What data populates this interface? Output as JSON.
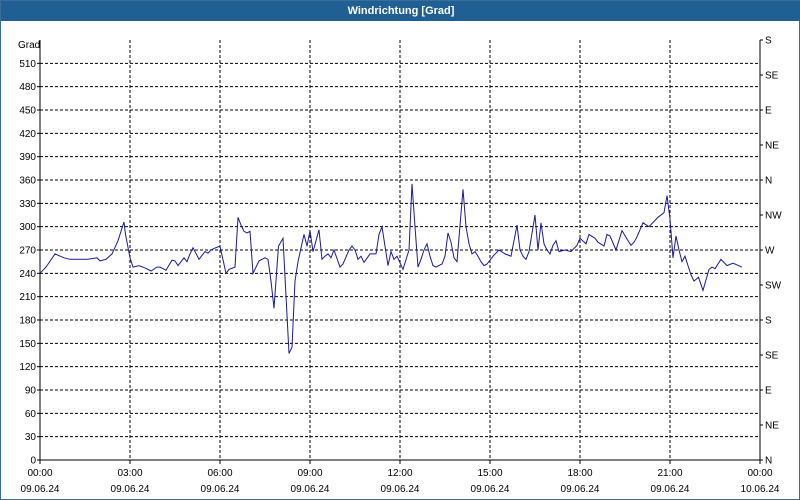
{
  "window": {
    "title": "Windrichtung [Grad]"
  },
  "chart_data": {
    "type": "line",
    "title": "Windrichtung [Grad]",
    "ylabel": "Grad",
    "ylim": [
      0,
      540
    ],
    "y_ticks": [
      0,
      30,
      60,
      90,
      120,
      150,
      180,
      210,
      240,
      270,
      300,
      330,
      360,
      390,
      420,
      450,
      480,
      510
    ],
    "right_axis_labels": [
      "N",
      "NE",
      "E",
      "SE",
      "S",
      "SW",
      "W",
      "NW",
      "N",
      "NE",
      "E",
      "SE",
      "S"
    ],
    "right_axis_values": [
      0,
      45,
      90,
      135,
      180,
      225,
      270,
      315,
      360,
      405,
      450,
      495,
      540
    ],
    "x_ticks": [
      {
        "time": "00:00",
        "date": "09.06.24"
      },
      {
        "time": "03:00",
        "date": "09.06.24"
      },
      {
        "time": "06:00",
        "date": "09.06.24"
      },
      {
        "time": "09:00",
        "date": "09.06.24"
      },
      {
        "time": "12:00",
        "date": "09.06.24"
      },
      {
        "time": "15:00",
        "date": "09.06.24"
      },
      {
        "time": "18:00",
        "date": "09.06.24"
      },
      {
        "time": "21:00",
        "date": "09.06.24"
      },
      {
        "time": "00:00",
        "date": "10.06.24"
      }
    ],
    "xlim_hours": [
      0,
      24
    ],
    "grid": true,
    "line_color": "#1a1a9c",
    "series": [
      {
        "x_hours": [
          0.0,
          0.2,
          0.5,
          0.8,
          1.0,
          1.3,
          1.6,
          1.9,
          2.0,
          2.2,
          2.4,
          2.6,
          2.8,
          2.85,
          3.0,
          3.1,
          3.3,
          3.5,
          3.7,
          3.9,
          4.0,
          4.2,
          4.4,
          4.5,
          4.6,
          4.8,
          4.9,
          5.0,
          5.1,
          5.3,
          5.5,
          5.6,
          5.7,
          5.8,
          6.0,
          6.2,
          6.3,
          6.5,
          6.6,
          6.7,
          6.8,
          6.9,
          7.0,
          7.1,
          7.3,
          7.5,
          7.6,
          7.7,
          7.8,
          7.95,
          8.1,
          8.3,
          8.4,
          8.5,
          8.6,
          8.8,
          8.9,
          9.0,
          9.1,
          9.2,
          9.3,
          9.4,
          9.5,
          9.6,
          9.7,
          9.8,
          10.0,
          10.1,
          10.3,
          10.4,
          10.5,
          10.6,
          10.7,
          10.8,
          11.0,
          11.2,
          11.3,
          11.4,
          11.6,
          11.7,
          11.8,
          11.9,
          12.1,
          12.3,
          12.4,
          12.5,
          12.6,
          12.7,
          12.8,
          12.9,
          13.0,
          13.1,
          13.2,
          13.4,
          13.5,
          13.6,
          13.7,
          13.8,
          13.9,
          14.1,
          14.2,
          14.3,
          14.4,
          14.5,
          14.6,
          14.7,
          14.8,
          14.9,
          15.1,
          15.3,
          15.5,
          15.7,
          15.9,
          16.0,
          16.1,
          16.2,
          16.3,
          16.5,
          16.6,
          16.7,
          16.8,
          16.9,
          17.0,
          17.1,
          17.2,
          17.3,
          17.5,
          17.7,
          17.9,
          18.0,
          18.2,
          18.3,
          18.5,
          18.6,
          18.8,
          18.9,
          19.0,
          19.2,
          19.4,
          19.6,
          19.7,
          19.8,
          19.9,
          20.1,
          20.3,
          20.5,
          20.6,
          20.8,
          20.9,
          21.0,
          21.1,
          21.2,
          21.3,
          21.4,
          21.5,
          21.6,
          21.7,
          21.8,
          21.95,
          22.1,
          22.3,
          22.4,
          22.5,
          22.7,
          22.9,
          23.1,
          23.4,
          23.6,
          23.8,
          24.0
        ],
        "values": [
          240,
          248,
          265,
          260,
          258,
          258,
          258,
          260,
          256,
          258,
          265,
          282,
          306,
          290,
          260,
          248,
          250,
          247,
          243,
          248,
          248,
          244,
          257,
          256,
          250,
          260,
          255,
          265,
          273,
          258,
          268,
          266,
          270,
          272,
          275,
          240,
          245,
          248,
          312,
          302,
          294,
          292,
          294,
          240,
          256,
          260,
          258,
          230,
          195,
          275,
          285,
          137,
          145,
          230,
          255,
          290,
          275,
          295,
          268,
          282,
          296,
          258,
          262,
          265,
          260,
          270,
          248,
          252,
          270,
          275,
          270,
          258,
          262,
          254,
          265,
          265,
          290,
          300,
          250,
          268,
          258,
          262,
          245,
          270,
          355,
          300,
          248,
          258,
          270,
          278,
          262,
          250,
          248,
          252,
          262,
          292,
          280,
          260,
          255,
          348,
          300,
          278,
          265,
          268,
          262,
          255,
          250,
          252,
          262,
          270,
          265,
          262,
          302,
          270,
          262,
          258,
          268,
          315,
          270,
          305,
          278,
          270,
          265,
          276,
          282,
          268,
          270,
          268,
          276,
          285,
          278,
          290,
          285,
          280,
          275,
          290,
          288,
          270,
          295,
          282,
          276,
          280,
          287,
          305,
          300,
          308,
          312,
          318,
          340,
          310,
          260,
          288,
          270,
          255,
          262,
          250,
          238,
          230,
          235,
          218,
          245,
          248,
          246,
          258,
          250,
          253,
          248
        ]
      }
    ]
  }
}
